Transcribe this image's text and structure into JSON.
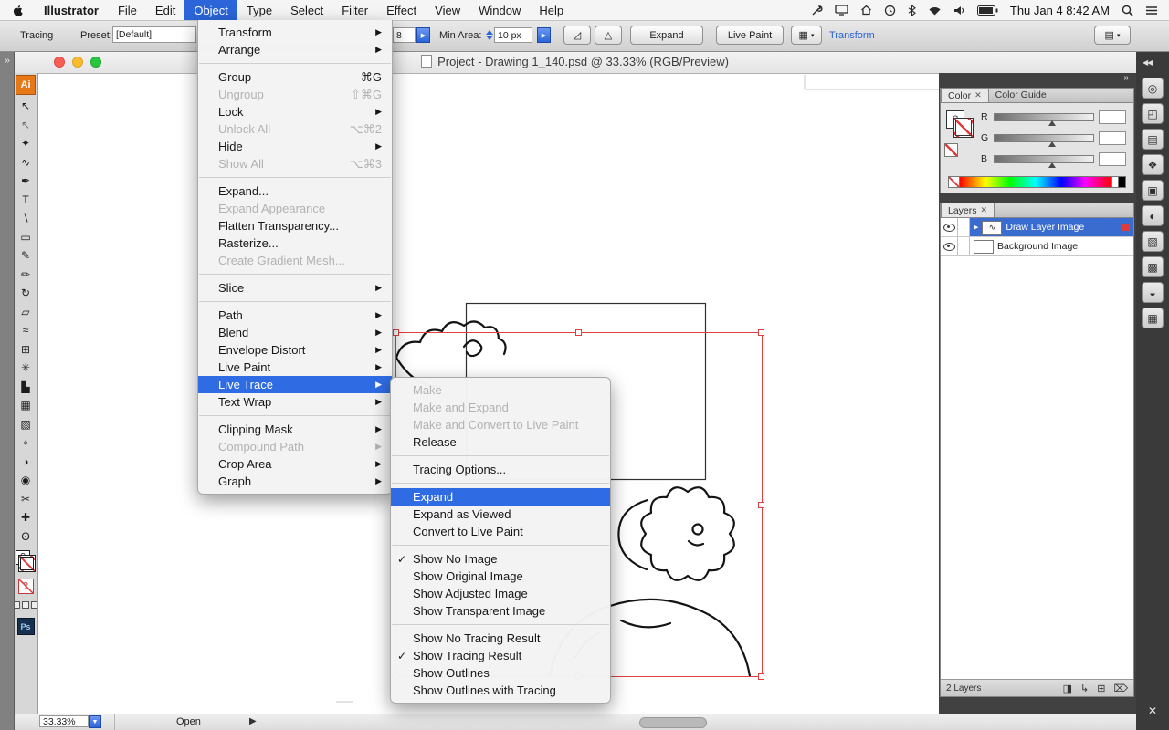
{
  "colors": {
    "accent_blue": "#2b65d9",
    "menu_highlight": "#2f6be2",
    "selection_red": "#e04040",
    "layer_selected": "#3a6cd0"
  },
  "glyphs": {
    "check": "✓",
    "submenu_arrow": "▶",
    "popup_arrow": "▶",
    "dropdown": "▼",
    "expander": "▶",
    "dock_collapse": "◀◀",
    "dock_expand": "»",
    "close": "✕",
    "panel_menu": "▾"
  },
  "menubar": {
    "app_name": "Illustrator",
    "items": [
      "File",
      "Edit",
      "Object",
      "Type",
      "Select",
      "Filter",
      "Effect",
      "View",
      "Window",
      "Help"
    ],
    "active_item": "Object",
    "clock": "Thu Jan 4 8:42 AM"
  },
  "control_bar": {
    "tracing_label": "Tracing",
    "preset_label": "Preset:",
    "preset_value": "[Default]",
    "threshold_value": "8",
    "min_area_label": "Min Area:",
    "min_area_value": "10 px",
    "corner_icon": "◿",
    "angle_icon": "△",
    "expand_button": "Expand",
    "live_paint_button": "Live Paint",
    "grid_icon": "▦",
    "transform_link": "Transform",
    "panel_icon": "▤"
  },
  "window": {
    "title": "Project - Drawing 1_140.psd @ 33.33% (RGB/Preview)"
  },
  "object_menu": {
    "items": [
      {
        "label": "Transform",
        "submenu": true
      },
      {
        "label": "Arrange",
        "submenu": true
      },
      {
        "type": "sep"
      },
      {
        "label": "Group",
        "shortcut": "⌘G"
      },
      {
        "label": "Ungroup",
        "shortcut": "⇧⌘G",
        "disabled": true
      },
      {
        "label": "Lock",
        "submenu": true
      },
      {
        "label": "Unlock All",
        "shortcut": "⌥⌘2",
        "disabled": true
      },
      {
        "label": "Hide",
        "submenu": true
      },
      {
        "label": "Show All",
        "shortcut": "⌥⌘3",
        "disabled": true
      },
      {
        "type": "sep"
      },
      {
        "label": "Expand..."
      },
      {
        "label": "Expand Appearance",
        "disabled": true
      },
      {
        "label": "Flatten Transparency..."
      },
      {
        "label": "Rasterize..."
      },
      {
        "label": "Create Gradient Mesh...",
        "disabled": true
      },
      {
        "type": "sep"
      },
      {
        "label": "Slice",
        "submenu": true
      },
      {
        "type": "sep"
      },
      {
        "label": "Path",
        "submenu": true
      },
      {
        "label": "Blend",
        "submenu": true
      },
      {
        "label": "Envelope Distort",
        "submenu": true
      },
      {
        "label": "Live Paint",
        "submenu": true
      },
      {
        "label": "Live Trace",
        "submenu": true,
        "highlighted": true
      },
      {
        "label": "Text Wrap",
        "submenu": true
      },
      {
        "type": "sep"
      },
      {
        "label": "Clipping Mask",
        "submenu": true
      },
      {
        "label": "Compound Path",
        "submenu": true,
        "disabled": true
      },
      {
        "label": "Crop Area",
        "submenu": true
      },
      {
        "label": "Graph",
        "submenu": true
      }
    ]
  },
  "live_trace_menu": {
    "items": [
      {
        "label": "Make",
        "disabled": true
      },
      {
        "label": "Make and Expand",
        "disabled": true
      },
      {
        "label": "Make and Convert to Live Paint",
        "disabled": true
      },
      {
        "label": "Release"
      },
      {
        "type": "sep"
      },
      {
        "label": "Tracing Options..."
      },
      {
        "type": "sep"
      },
      {
        "label": "Expand",
        "highlighted": true
      },
      {
        "label": "Expand as Viewed"
      },
      {
        "label": "Convert to Live Paint"
      },
      {
        "type": "sep"
      },
      {
        "label": "Show No Image",
        "checked": true
      },
      {
        "label": "Show Original Image"
      },
      {
        "label": "Show Adjusted Image"
      },
      {
        "label": "Show Transparent Image"
      },
      {
        "type": "sep"
      },
      {
        "label": "Show No Tracing Result"
      },
      {
        "label": "Show Tracing Result",
        "checked": true
      },
      {
        "label": "Show Outlines"
      },
      {
        "label": "Show Outlines with Tracing"
      }
    ]
  },
  "toolbar": {
    "logo": "Ai",
    "ps_logo": "Ps",
    "fill_unknown": "?",
    "question_badge": "?",
    "tools": [
      {
        "name": "selection-tool",
        "glyph": "↖"
      },
      {
        "name": "direct-selection-tool",
        "glyph": "↖",
        "variant": "light"
      },
      {
        "name": "magic-wand-tool",
        "glyph": "✦"
      },
      {
        "name": "lasso-tool",
        "glyph": "∿"
      },
      {
        "name": "pen-tool",
        "glyph": "✒"
      },
      {
        "name": "type-tool",
        "glyph": "T"
      },
      {
        "name": "line-segment-tool",
        "glyph": "∖"
      },
      {
        "name": "rectangle-tool",
        "glyph": "▭"
      },
      {
        "name": "paintbrush-tool",
        "glyph": "✎"
      },
      {
        "name": "pencil-tool",
        "glyph": "✏"
      },
      {
        "name": "rotate-tool",
        "glyph": "↻"
      },
      {
        "name": "scale-tool",
        "glyph": "▱"
      },
      {
        "name": "warp-tool",
        "glyph": "≈"
      },
      {
        "name": "free-transform-tool",
        "glyph": "⊞"
      },
      {
        "name": "symbol-sprayer-tool",
        "glyph": "✳"
      },
      {
        "name": "column-graph-tool",
        "glyph": "▙"
      },
      {
        "name": "mesh-tool",
        "glyph": "▦"
      },
      {
        "name": "gradient-tool",
        "glyph": "▧"
      },
      {
        "name": "eyedropper-tool",
        "glyph": "⌖"
      },
      {
        "name": "blend-tool",
        "glyph": "◑"
      },
      {
        "name": "live-paint-bucket-tool",
        "glyph": "◉"
      },
      {
        "name": "slice-tool",
        "glyph": "✂"
      },
      {
        "name": "hand-tool",
        "glyph": "✚"
      },
      {
        "name": "zoom-tool",
        "glyph": "ʘ"
      }
    ]
  },
  "color_panel": {
    "tab_color": "Color",
    "tab_color_guide": "Color Guide",
    "channels": [
      "R",
      "G",
      "B"
    ]
  },
  "layers_panel": {
    "tab": "Layers",
    "layers": [
      {
        "name": "Draw Layer Image",
        "selected": true,
        "thumb_squiggle": true
      },
      {
        "name": "Background Image",
        "selected": false,
        "thumb_squiggle": false
      }
    ],
    "count_label": "2 Layers",
    "footer_icons": [
      {
        "name": "make-clipping-mask-icon",
        "glyph": "◨"
      },
      {
        "name": "create-sublayer-icon",
        "glyph": "↳"
      },
      {
        "name": "create-layer-icon",
        "glyph": "⊞"
      },
      {
        "name": "delete-layer-icon",
        "glyph": "⌦"
      }
    ]
  },
  "right_strip": {
    "icons": [
      {
        "name": "appearance-panel-icon",
        "glyph": "◎"
      },
      {
        "name": "navigator-panel-icon",
        "glyph": "◰"
      },
      {
        "name": "swatches-panel-icon",
        "glyph": "▤"
      },
      {
        "name": "symbols-panel-icon",
        "glyph": "❖"
      },
      {
        "name": "links-panel-icon",
        "glyph": "▣"
      },
      {
        "name": "transparency-panel-icon",
        "glyph": "◐"
      },
      {
        "name": "gradient-panel-icon",
        "glyph": "▧"
      },
      {
        "name": "graphic-styles-panel-icon",
        "glyph": "▩"
      },
      {
        "name": "stroke-panel-icon",
        "glyph": "◒"
      },
      {
        "name": "brushes-panel-icon",
        "glyph": "▦"
      }
    ]
  },
  "status_bar": {
    "zoom": "33.33%",
    "status": "Open"
  }
}
